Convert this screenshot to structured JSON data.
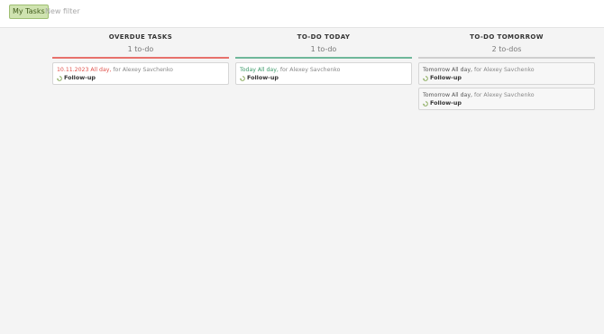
{
  "toolbar": {
    "filter_label": "My Tasks",
    "new_filter_placeholder": "New filter"
  },
  "columns": [
    {
      "title": "OVERDUE TASKS",
      "count": "1 to-do",
      "accent": "#e7716c",
      "cards": [
        {
          "due": "10.11.2023 All day,",
          "assignee": "for Alexey Savchenko",
          "task": "Follow-up",
          "icon": "follow-up-icon"
        }
      ]
    },
    {
      "title": "TO-DO TODAY",
      "count": "1 to-do",
      "accent": "#6fb79a",
      "cards": [
        {
          "due": "Today All day,",
          "assignee": "for Alexey Savchenko",
          "task": "Follow-up",
          "icon": "follow-up-icon"
        }
      ]
    },
    {
      "title": "TO-DO TOMORROW",
      "count": "2 to-dos",
      "accent": "#cfcfcf",
      "cards": [
        {
          "due": "Tomorrow All day,",
          "assignee": "for Alexey Savchenko",
          "task": "Follow-up",
          "icon": "follow-up-icon"
        },
        {
          "due": "Tomorrow All day,",
          "assignee": "for Alexey Savchenko",
          "task": "Follow-up",
          "icon": "follow-up-icon"
        }
      ]
    }
  ]
}
